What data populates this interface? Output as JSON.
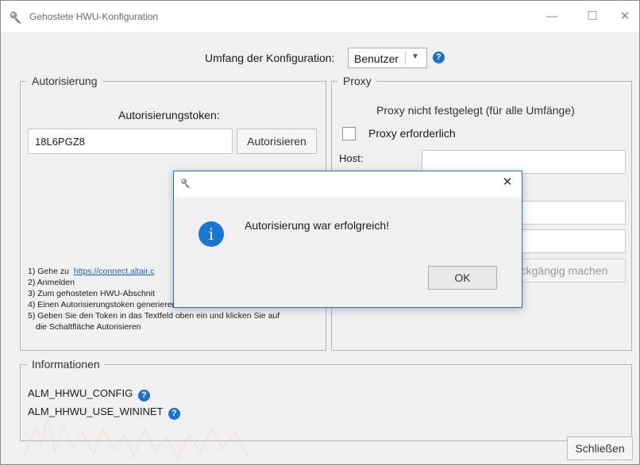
{
  "window": {
    "title": "Gehostete HWU-Konfiguration",
    "minimize": "—",
    "maximize": "☐",
    "close": "✕"
  },
  "scope": {
    "label": "Umfang der Konfiguration:",
    "selected": "Benutzer",
    "arrow": "▼",
    "help": "?"
  },
  "authorization": {
    "legend": "Autorisierung",
    "token_label": "Autorisierungstoken:",
    "token_value": "18L6PGZ8",
    "authorize_button": "Autorisieren",
    "steps": {
      "step1_prefix": "1) Gehe zu",
      "step1_link": "https://connect.altair.c",
      "step2": "2) Anmelden",
      "step3": "3) Zum gehosteten HWU-Abschnit",
      "step4": "4) Einen Autorisierungstoken generieren",
      "step5a": "5) Geben Sie den Token in das Textfeld oben ein und klicken Sie auf",
      "step5b": "die Schaltfläche Autorisieren"
    }
  },
  "proxy": {
    "legend": "Proxy",
    "status": "Proxy nicht festgelegt (für alle Umfänge)",
    "checkbox_label": "Proxy erforderlich",
    "host_label": "Host:",
    "undo_button": "ckgängig machen"
  },
  "information": {
    "legend": "Informationen",
    "items": [
      "ALM_HHWU_CONFIG",
      "ALM_HHWU_USE_WININET"
    ],
    "help": "?"
  },
  "close_button": "Schließen",
  "dialog": {
    "close": "✕",
    "icon": "i",
    "message": "Autorisierung war erfolgreich!",
    "ok_button": "OK"
  },
  "colors": {
    "accent": "#1979ca",
    "help_icon": "#1e6fd0",
    "link": "#1a5fc9"
  },
  "icons": {
    "app": "key-icon",
    "help": "help-circle-icon",
    "info": "info-icon"
  }
}
